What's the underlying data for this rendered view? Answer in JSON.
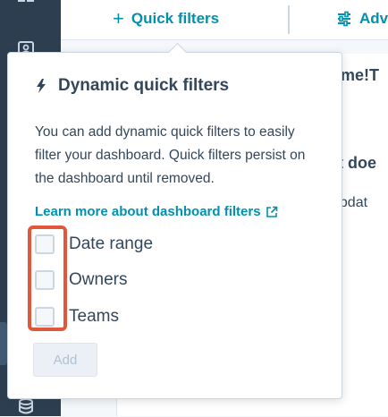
{
  "topbar": {
    "quick_filters_label": "Quick filters",
    "advanced_label": "Adv"
  },
  "background": {
    "line1": "ame!T",
    "line2": "rt doe",
    "line3": "updat"
  },
  "popover": {
    "title": "Dynamic quick filters",
    "description": "You can add dynamic quick filters to easily filter your dashboard. Quick filters persist on the dashboard until removed.",
    "learn_more_label": "Learn more about dashboard filters",
    "options": [
      {
        "label": "Date range",
        "checked": false
      },
      {
        "label": "Owners",
        "checked": false
      },
      {
        "label": "Teams",
        "checked": false
      }
    ],
    "add_label": "Add"
  },
  "colors": {
    "accent": "#0091ae",
    "sidebar": "#2d3e50",
    "highlight": "#e0573c",
    "text": "#33475b"
  },
  "icons": {
    "sidebar": [
      "grid-icon",
      "contacts-icon",
      "database-icon"
    ],
    "title": "lightning-icon",
    "link": "external-link-icon",
    "advanced": "sliders-icon"
  }
}
